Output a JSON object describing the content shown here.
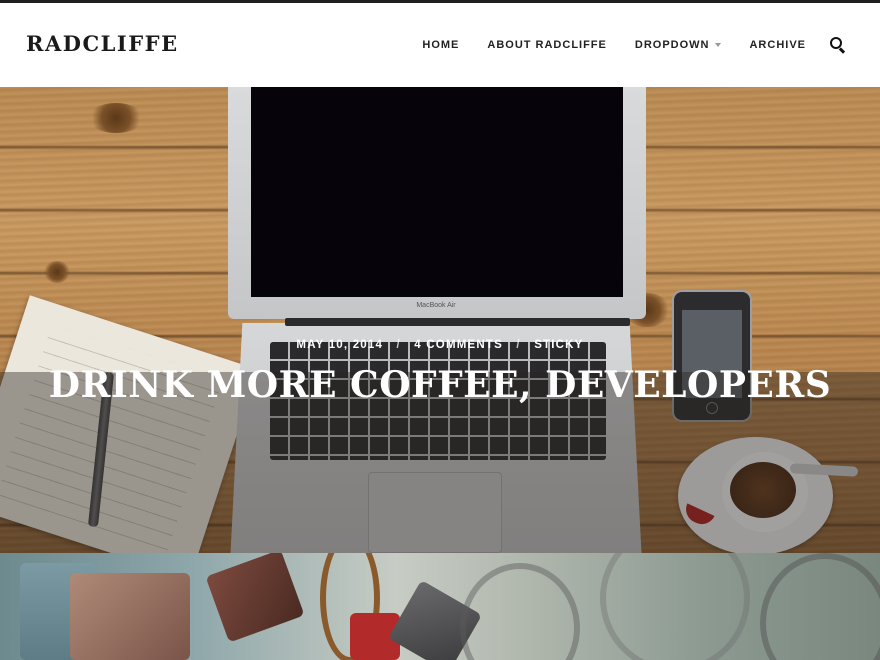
{
  "site": {
    "logo_text": "RADCLIFFE"
  },
  "nav": {
    "items": [
      {
        "label": "HOME"
      },
      {
        "label": "ABOUT RADCLIFFE"
      },
      {
        "label": "DROPDOWN",
        "has_dropdown": true
      },
      {
        "label": "ARCHIVE"
      }
    ],
    "search_icon": "search-icon"
  },
  "featured_post": {
    "date": "MAY 10, 2014",
    "comments": "4 COMMENTS",
    "category": "STICKY",
    "separator": "/",
    "title": "DRINK MORE COFFEE, DEVELOPERS",
    "image_text": "MacBook Air"
  },
  "colors": {
    "header_bg": "#ffffff",
    "text_dark": "#1a1a1a",
    "accent_bar": "#1f1f1f",
    "overlay_text": "#ffffff"
  }
}
